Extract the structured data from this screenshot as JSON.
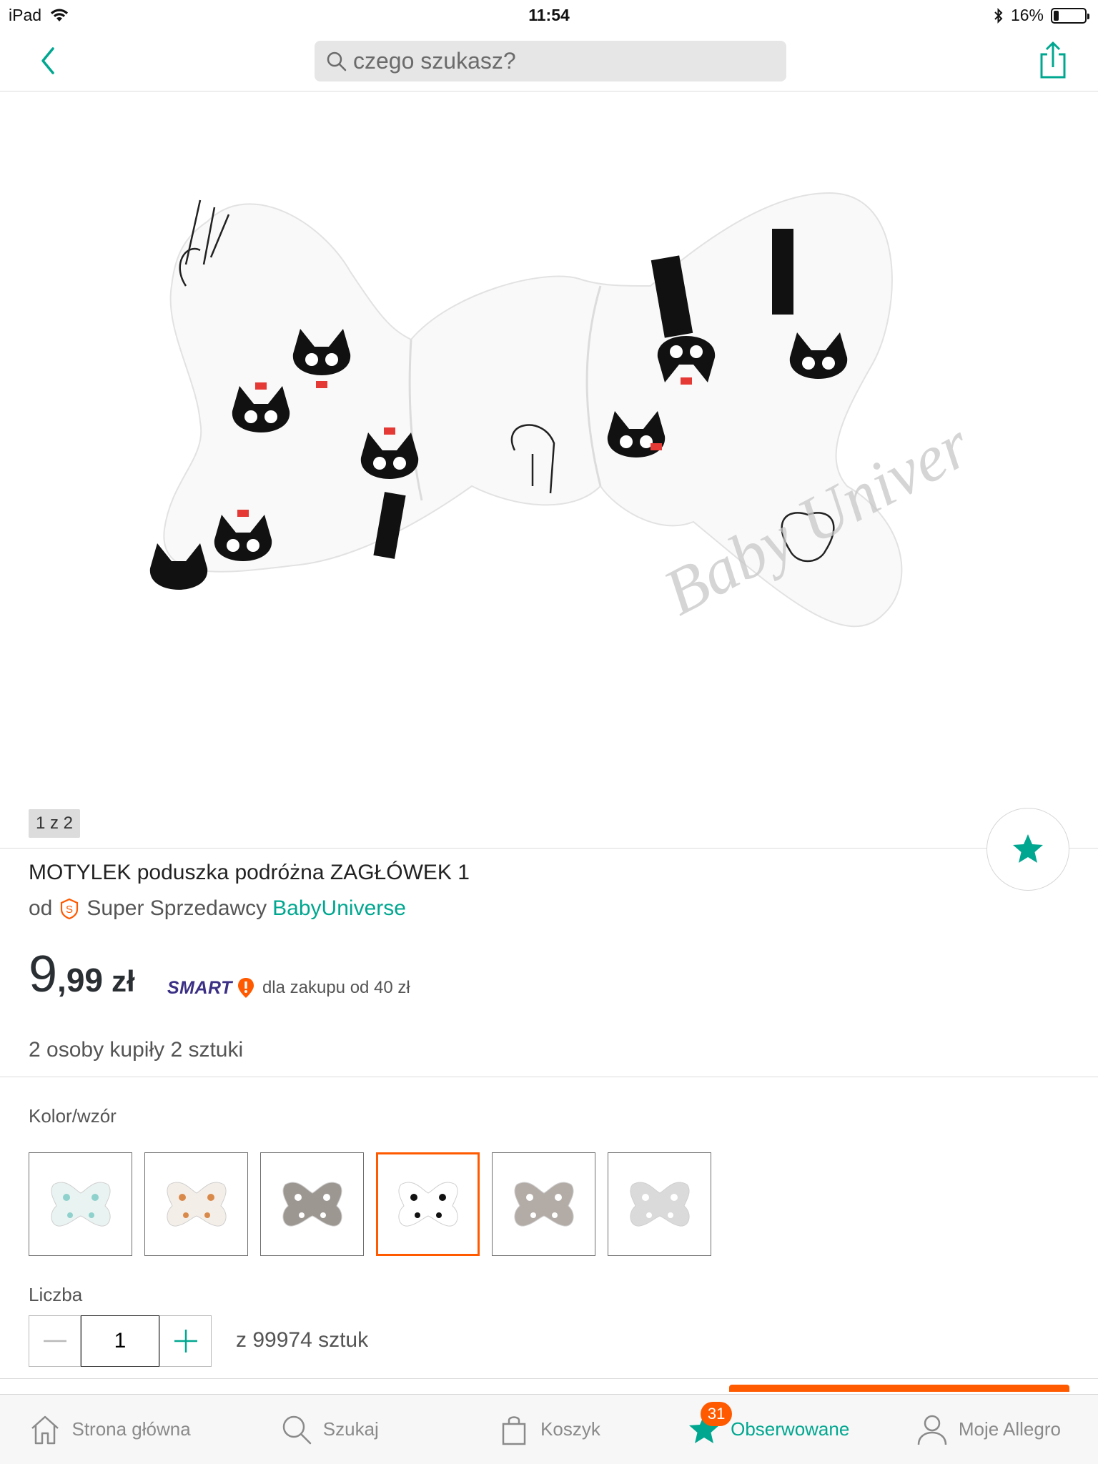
{
  "status_bar": {
    "device": "iPad",
    "time": "11:54",
    "battery": "16%",
    "battery_level": 0.16
  },
  "header": {
    "search_placeholder": "czego szukasz?"
  },
  "gallery": {
    "counter": "1 z 2",
    "watermark": "Baby Universe"
  },
  "product": {
    "title": "MOTYLEK poduszka podróżna ZAGŁÓWEK 1",
    "seller_prefix": "od",
    "seller_badge": "Super Sprzedawcy",
    "seller_name": "BabyUniverse",
    "price_integer": "9",
    "price_decimal": ",99",
    "price_currency": "zł",
    "smart_logo": "SMART",
    "smart_note": "dla zakupu od 40 zł",
    "buyers": "2 osoby kupiły 2 sztuki"
  },
  "variants": {
    "label": "Kolor/wzór",
    "selected_index": 3,
    "items": [
      {
        "name": "mint-clouds",
        "fill": "#e9f3f2",
        "accent": "#8fd1cc"
      },
      {
        "name": "foxes",
        "fill": "#f4eee8",
        "accent": "#d98a4b"
      },
      {
        "name": "grey-dots",
        "fill": "#9d9792",
        "accent": "#ffffff"
      },
      {
        "name": "cats",
        "fill": "#ffffff",
        "accent": "#111111"
      },
      {
        "name": "grey-owls",
        "fill": "#b3aca6",
        "accent": "#ffffff"
      },
      {
        "name": "white-dots",
        "fill": "#dadada",
        "accent": "#ffffff"
      }
    ]
  },
  "quantity": {
    "label": "Liczba",
    "value": "1",
    "available": "z 99974 sztuk"
  },
  "tabs": [
    {
      "label": "Strona główna",
      "icon": "home-icon",
      "active": false
    },
    {
      "label": "Szukaj",
      "icon": "search-icon",
      "active": false
    },
    {
      "label": "Koszyk",
      "icon": "bag-icon",
      "active": false
    },
    {
      "label": "Obserwowane",
      "icon": "star-icon",
      "active": true,
      "badge": "31"
    },
    {
      "label": "Moje Allegro",
      "icon": "person-icon",
      "active": false
    }
  ],
  "colors": {
    "accent_teal": "#00a790",
    "accent_orange": "#ff5a00",
    "smart_purple": "#3b3085"
  }
}
